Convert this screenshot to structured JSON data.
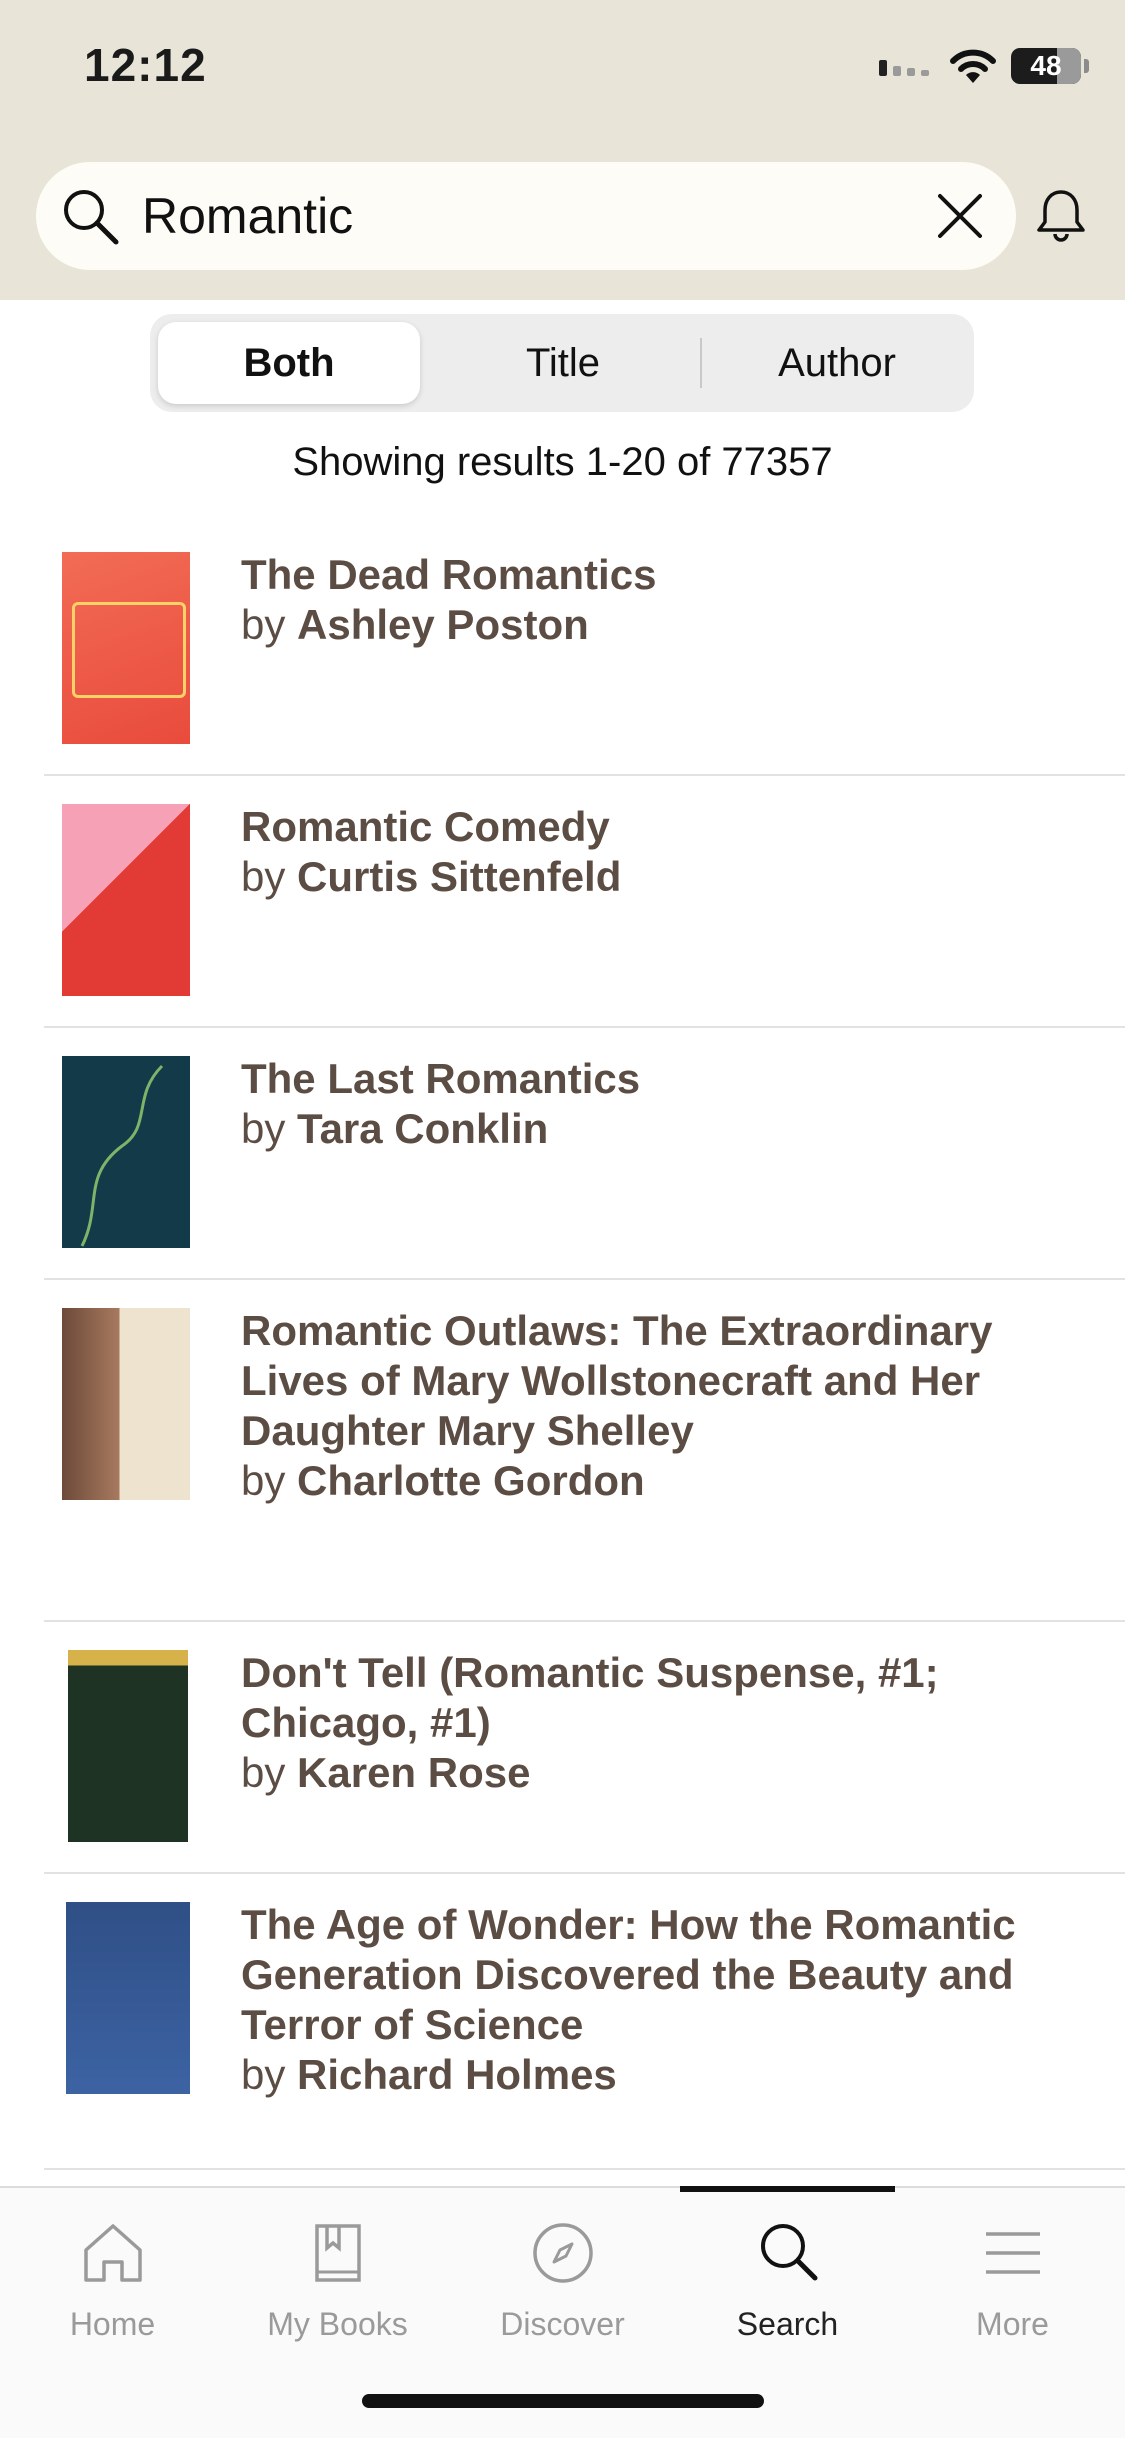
{
  "status_bar": {
    "time": "12:12",
    "battery": "48"
  },
  "search": {
    "query": "Romantic"
  },
  "segmented": {
    "options": [
      "Both",
      "Title",
      "Author"
    ],
    "selected": "Both"
  },
  "results_summary": "Showing results 1-20 of 77357",
  "results": [
    {
      "title": "The Dead Romantics",
      "by": "by",
      "author": "Ashley Poston",
      "cover_colors": [
        "#f0624d",
        "#ffd166"
      ]
    },
    {
      "title": "Romantic Comedy",
      "by": "by",
      "author": "Curtis Sittenfeld",
      "cover_colors": [
        "#f7a1b7",
        "#e23b35"
      ]
    },
    {
      "title": "The Last Romantics",
      "by": "by",
      "author": "Tara Conklin",
      "cover_colors": [
        "#123a48",
        "#7fb36a"
      ]
    },
    {
      "title": "Romantic Outlaws: The Extraordinary Lives of Mary Wollstonecraft and Her Daughter Mary Shelley",
      "by": "by",
      "author": "Charlotte Gordon",
      "cover_colors": [
        "#6d4a3a",
        "#ede3cf"
      ]
    },
    {
      "title": "Don't Tell (Romantic Suspense, #1; Chicago, #1)",
      "by": "by",
      "author": "Karen Rose",
      "cover_colors": [
        "#1f3325",
        "#d7b14a"
      ]
    },
    {
      "title": "The Age of Wonder: How the Romantic Generation Discovered the Beauty and Terror of Science",
      "by": "by",
      "author": "Richard Holmes",
      "cover_colors": [
        "#2f4f86",
        "#c9d4ef"
      ]
    }
  ],
  "tabs": [
    {
      "label": "Home",
      "icon": "home-icon"
    },
    {
      "label": "My Books",
      "icon": "books-icon"
    },
    {
      "label": "Discover",
      "icon": "compass-icon"
    },
    {
      "label": "Search",
      "icon": "search-icon",
      "active": true
    },
    {
      "label": "More",
      "icon": "menu-icon"
    }
  ],
  "colors": {
    "header_bg": "#e8e5d8",
    "link_brown": "#5b4d43"
  }
}
